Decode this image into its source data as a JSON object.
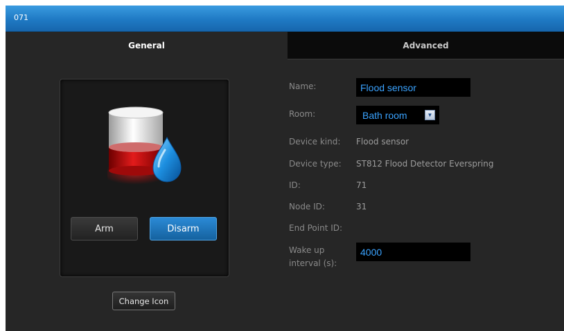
{
  "window": {
    "title": "071"
  },
  "tabs": {
    "general": "General",
    "advanced": "Advanced"
  },
  "device": {
    "icon": "flood-sensor-icon",
    "arm_label": "Arm",
    "disarm_label": "Disarm",
    "change_icon_label": "Change Icon"
  },
  "details": {
    "name_label": "Name:",
    "name_value": "Flood sensor",
    "room_label": "Room:",
    "room_value": "Bath room",
    "device_kind_label": "Device kind:",
    "device_kind_value": "Flood sensor",
    "device_type_label": "Device type:",
    "device_type_value": "ST812 Flood Detector Everspring",
    "id_label": "ID:",
    "id_value": "71",
    "node_id_label": "Node ID:",
    "node_id_value": "31",
    "end_point_label": "End Point ID:",
    "wakeup_label_line1": "Wake up",
    "wakeup_label_line2": "interval (s):",
    "wakeup_value": "4000"
  },
  "colors": {
    "accent": "#1f7ac4",
    "field_text": "#3aa3ff",
    "background": "#262626"
  }
}
